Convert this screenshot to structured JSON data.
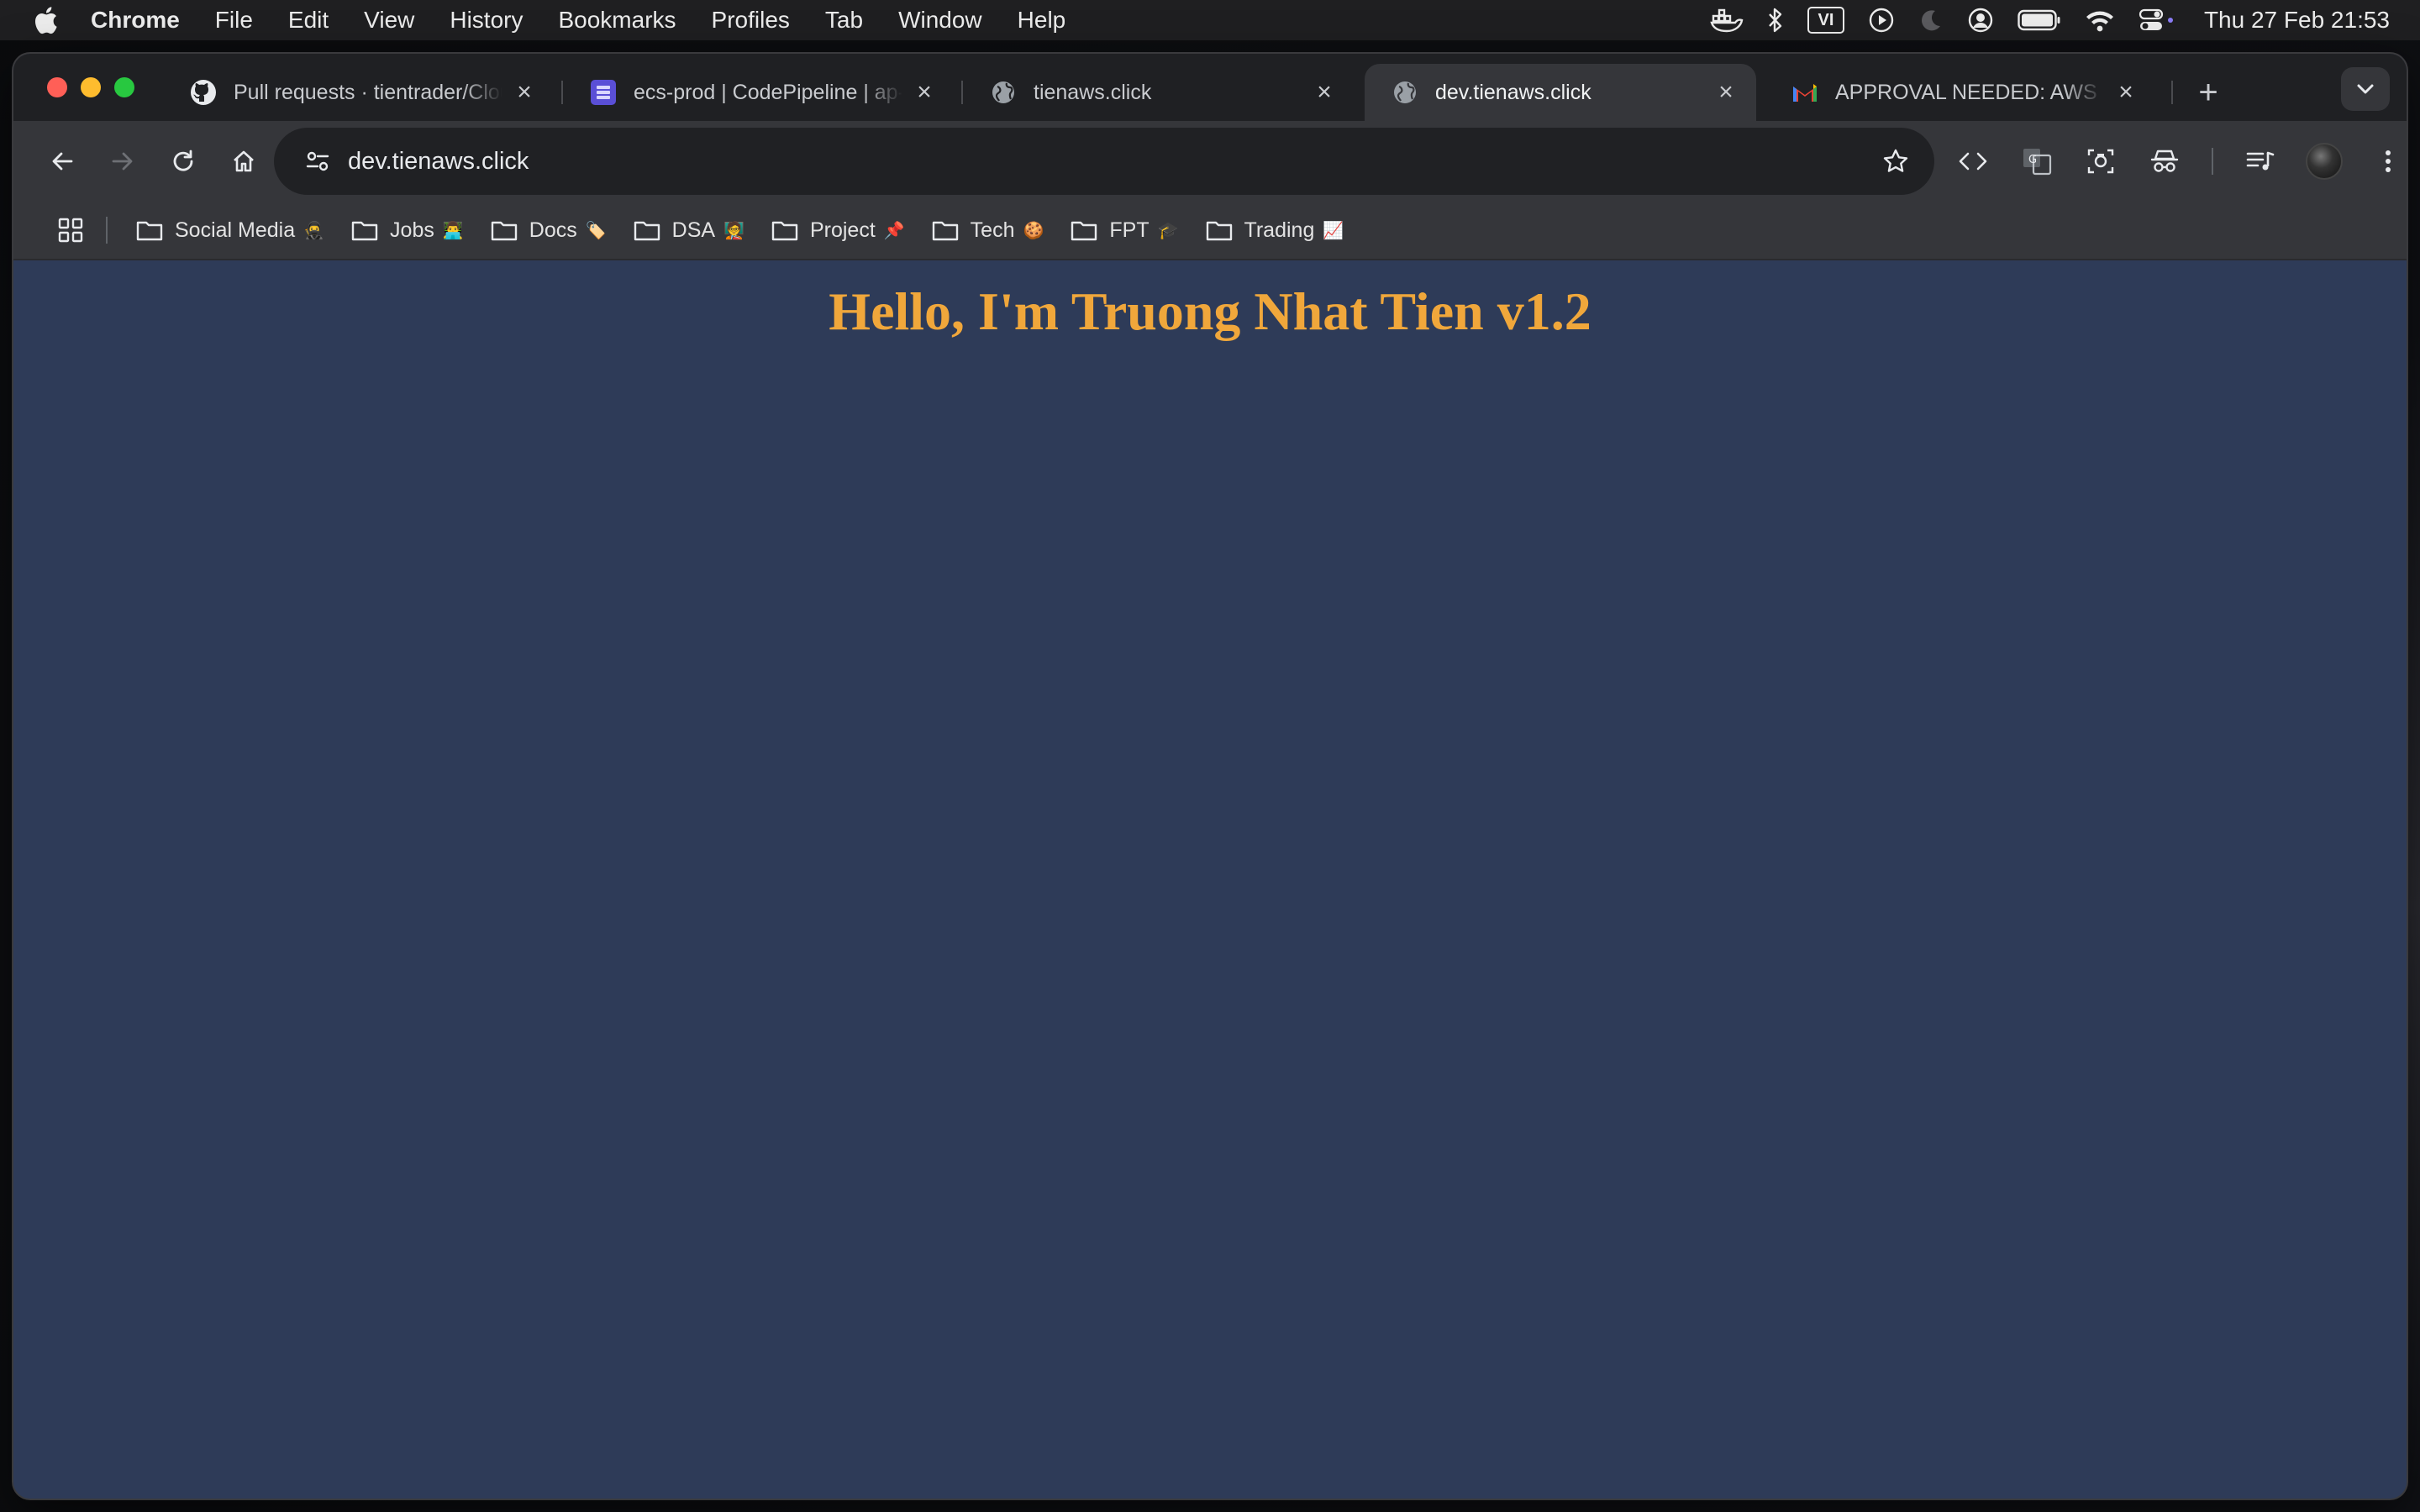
{
  "menubar": {
    "app": "Chrome",
    "items": [
      "File",
      "Edit",
      "View",
      "History",
      "Bookmarks",
      "Profiles",
      "Tab",
      "Window",
      "Help"
    ],
    "input_method": "VI",
    "clock": "Thu 27 Feb  21:53"
  },
  "tabs": [
    {
      "title": "Pull requests · tientrader/Clou",
      "favicon": "github-icon"
    },
    {
      "title": "ecs-prod | CodePipeline | ap-",
      "favicon": "codepipeline-icon"
    },
    {
      "title": "tienaws.click",
      "favicon": "globe-icon"
    },
    {
      "title": "dev.tienaws.click",
      "favicon": "globe-icon",
      "active": true
    },
    {
      "title": "APPROVAL NEEDED: AWS Co",
      "favicon": "gmail-icon"
    }
  ],
  "omnibox": {
    "url": "dev.tienaws.click"
  },
  "bookmarks": [
    {
      "label": "Social Media",
      "emoji": "🥷"
    },
    {
      "label": "Jobs",
      "emoji": "👨‍💻"
    },
    {
      "label": "Docs",
      "emoji": "🏷️"
    },
    {
      "label": "DSA",
      "emoji": "🧑‍🏫"
    },
    {
      "label": "Project",
      "emoji": "📌"
    },
    {
      "label": "Tech",
      "emoji": "🍪"
    },
    {
      "label": "FPT",
      "emoji": "🎓"
    },
    {
      "label": "Trading",
      "emoji": "📈"
    }
  ],
  "page": {
    "heading": "Hello, I'm Truong Nhat Tien v1.2",
    "background": "#2e3b58",
    "heading_color": "#f0a73b"
  }
}
